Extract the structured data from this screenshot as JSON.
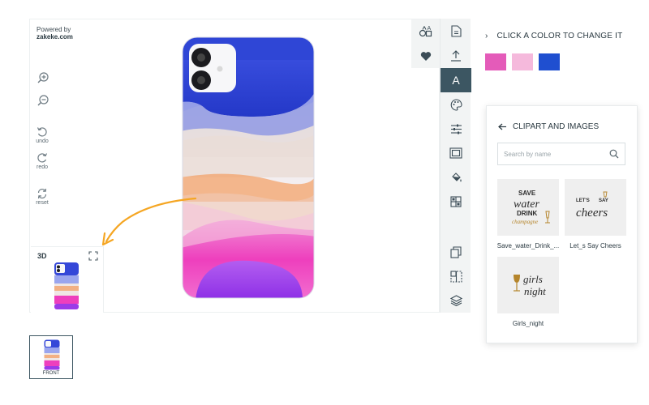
{
  "powered": {
    "line1": "Powered by",
    "brand": "zakeke.com"
  },
  "left_tools": {
    "zoom_in": "zoom-in",
    "zoom_out": "zoom-out",
    "undo": "undo",
    "redo": "redo",
    "reset": "reset"
  },
  "preview": {
    "label": "3D"
  },
  "color_section": {
    "title": "CLICK A COLOR TO CHANGE IT",
    "swatches": [
      "#e45bb9",
      "#f5b9dc",
      "#1f4fd0"
    ]
  },
  "clipart": {
    "title": "CLIPART AND IMAGES",
    "search_placeholder": "Search by name",
    "items": [
      {
        "caption": "Save_water_Drink_...",
        "art": [
          "SAVE",
          "water",
          "DRINK",
          "champagne"
        ]
      },
      {
        "caption": "Let_s Say Cheers",
        "art": [
          "LET'S",
          "SAY",
          "cheers"
        ]
      },
      {
        "caption": "Girls_night",
        "art": [
          "girls",
          "night"
        ]
      }
    ]
  },
  "sides": [
    {
      "label": "FRONT"
    }
  ],
  "colors": {
    "accent": "#3c5662",
    "toolbar_bg": "#f2f4f4",
    "arrow": "#f5a623",
    "case_blue": "#2f46d6",
    "case_pink": "#f03fbd",
    "case_purple": "#9b3be8",
    "case_orange": "#f3a36b"
  }
}
